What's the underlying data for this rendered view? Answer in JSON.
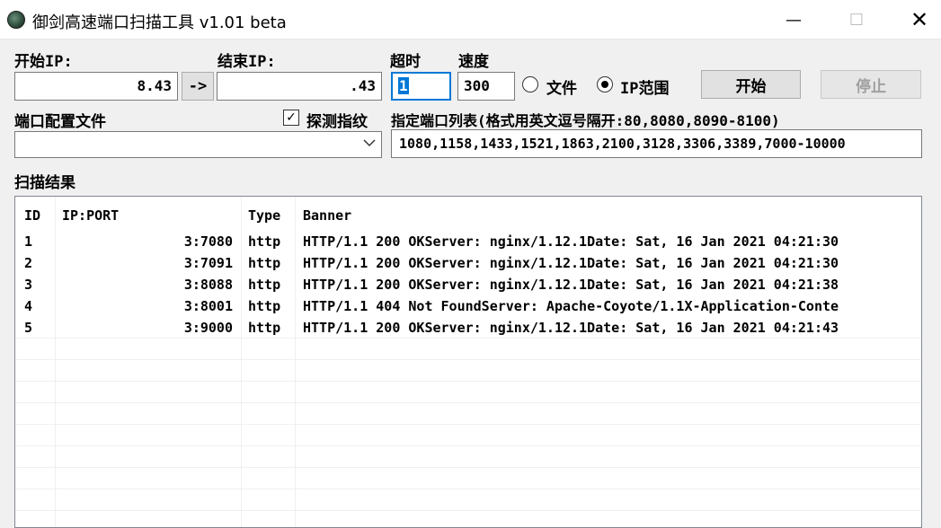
{
  "window": {
    "title": "御剑高速端口扫描工具 v1.01 beta",
    "controls": {
      "minimize": "—",
      "maximize": "☐",
      "close": "✕"
    }
  },
  "form": {
    "start_ip_label": "开始IP:",
    "start_ip_value": "8.43",
    "arrow_button": "->",
    "end_ip_label": "结束IP:",
    "end_ip_value": ".43",
    "timeout_label": "超时",
    "timeout_value": "1",
    "speed_label": "速度",
    "speed_value": "300",
    "radio_file_label": "文件",
    "radio_iprange_label": "IP范围",
    "start_button": "开始",
    "stop_button": "停止",
    "port_config_label": "端口配置文件",
    "detect_fingerprint_label": "探测指纹",
    "port_list_label": "指定端口列表(格式用英文逗号隔开:80,8080,8090-8100)",
    "port_list_value": "1080,1158,1433,1521,1863,2100,3128,3306,3389,7000-10000",
    "port_config_value": ""
  },
  "results": {
    "section_label": "扫描结果",
    "columns": {
      "id": "ID",
      "ip_port": "IP:PORT",
      "type": "Type",
      "banner": "Banner"
    },
    "rows": [
      {
        "id": "1",
        "ip_port": "3:7080",
        "type": "http",
        "banner": "HTTP/1.1 200 OKServer: nginx/1.12.1Date: Sat, 16 Jan 2021 04:21:30"
      },
      {
        "id": "2",
        "ip_port": "3:7091",
        "type": "http",
        "banner": "HTTP/1.1 200 OKServer: nginx/1.12.1Date: Sat, 16 Jan 2021 04:21:30"
      },
      {
        "id": "3",
        "ip_port": "3:8088",
        "type": "http",
        "banner": "HTTP/1.1 200 OKServer: nginx/1.12.1Date: Sat, 16 Jan 2021 04:21:38"
      },
      {
        "id": "4",
        "ip_port": "3:8001",
        "type": "http",
        "banner": "HTTP/1.1 404 Not FoundServer: Apache-Coyote/1.1X-Application-Conte"
      },
      {
        "id": "5",
        "ip_port": "3:9000",
        "type": "http",
        "banner": "HTTP/1.1 200 OKServer: nginx/1.12.1Date: Sat, 16 Jan 2021 04:21:43"
      }
    ]
  },
  "icons": {
    "app": "app-globe-icon",
    "dropdown": "chevron-down-icon",
    "checkbox_mark": "✓"
  },
  "colors": {
    "window_bg": "#f0f0f0",
    "focus_border": "#0078d7",
    "selection": "#0078d7"
  }
}
